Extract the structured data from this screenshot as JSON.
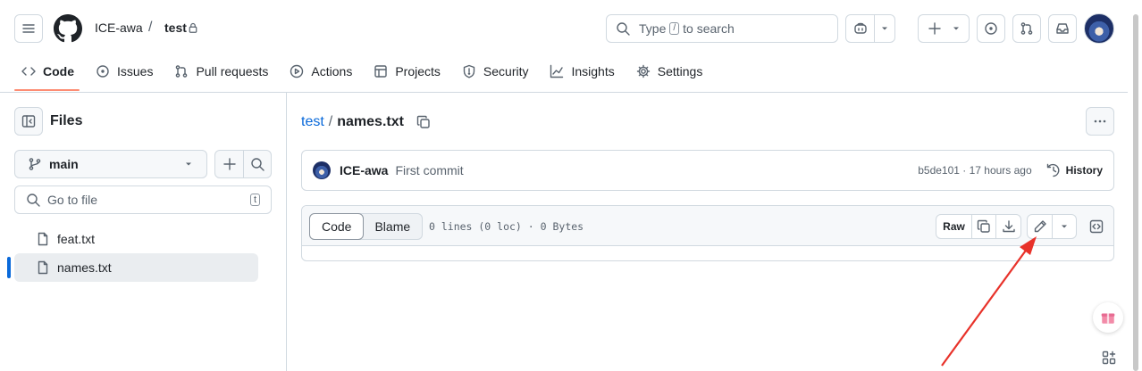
{
  "header": {
    "owner": "ICE-awa",
    "separator": "/",
    "repo": "test",
    "search_prefix": "Type",
    "search_key": "/",
    "search_suffix": "to search"
  },
  "tabs": [
    {
      "label": "Code",
      "icon": "code-icon"
    },
    {
      "label": "Issues",
      "icon": "issue-icon"
    },
    {
      "label": "Pull requests",
      "icon": "pull-request-icon"
    },
    {
      "label": "Actions",
      "icon": "play-icon"
    },
    {
      "label": "Projects",
      "icon": "table-icon"
    },
    {
      "label": "Security",
      "icon": "shield-icon"
    },
    {
      "label": "Insights",
      "icon": "graph-icon"
    },
    {
      "label": "Settings",
      "icon": "gear-icon"
    }
  ],
  "sidebar": {
    "title": "Files",
    "branch": "main",
    "goto_placeholder": "Go to file",
    "goto_shortcut": "t",
    "files": [
      {
        "name": "feat.txt",
        "selected": false
      },
      {
        "name": "names.txt",
        "selected": true
      }
    ]
  },
  "main": {
    "breadcrumb_repo": "test",
    "breadcrumb_sep": "/",
    "file_name": "names.txt",
    "commit": {
      "author": "ICE-awa",
      "message": "First commit",
      "hash_time": "b5de101 · 17 hours ago",
      "history_label": "History"
    },
    "view": {
      "code_label": "Code",
      "blame_label": "Blame",
      "stats": "0 lines (0 loc) · 0 Bytes",
      "raw_label": "Raw"
    }
  },
  "colors": {
    "accent_link": "#0969da",
    "tab_underline": "#fd8c73",
    "annotation_arrow": "#e8322a"
  }
}
